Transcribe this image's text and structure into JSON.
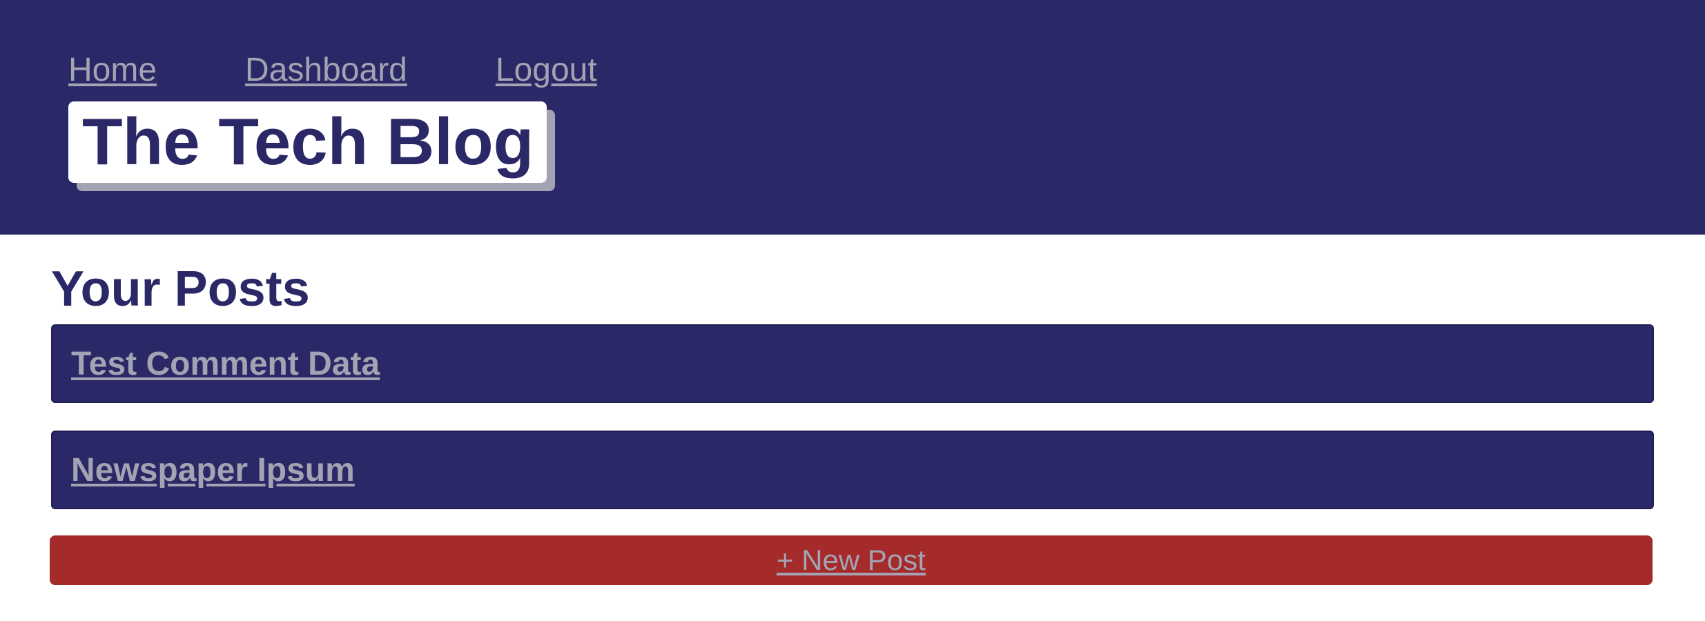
{
  "header": {
    "nav": {
      "home": "Home",
      "dashboard": "Dashboard",
      "logout": "Logout"
    },
    "brand_title": "The Tech Blog"
  },
  "main": {
    "section_title": "Your Posts",
    "posts": [
      {
        "title": "Test Comment Data"
      },
      {
        "title": "Newspaper Ipsum"
      }
    ],
    "new_post_label": "+ New Post"
  },
  "colors": {
    "header_bg": "#2a2866",
    "link_gray": "#a3a3b3",
    "new_post_red": "#a52a2a",
    "page_bg": "#ffffff"
  }
}
